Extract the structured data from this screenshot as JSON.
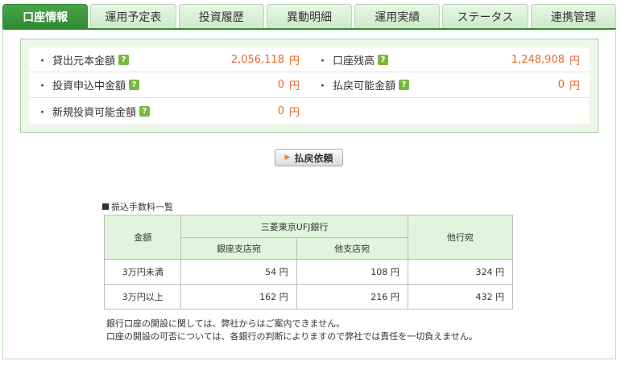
{
  "tabs": [
    {
      "label": "口座情報",
      "active": true
    },
    {
      "label": "運用予定表",
      "active": false
    },
    {
      "label": "投資履歴",
      "active": false
    },
    {
      "label": "異動明細",
      "active": false
    },
    {
      "label": "運用実績",
      "active": false
    },
    {
      "label": "ステータス",
      "active": false
    },
    {
      "label": "連携管理",
      "active": false
    }
  ],
  "summary": {
    "bullet": "・",
    "help_glyph": "?",
    "unit": "円",
    "loan_principal": {
      "label": "貸出元本金額",
      "value": "2,056,118"
    },
    "account_balance": {
      "label": "口座残高",
      "value": "1,248,908"
    },
    "pending_investment": {
      "label": "投資申込中金額",
      "value": "0"
    },
    "withdrawable": {
      "label": "払戻可能金額",
      "value": "0"
    },
    "new_investable": {
      "label": "新規投資可能金額",
      "value": "0"
    }
  },
  "withdraw_button": {
    "label": "払戻依頼"
  },
  "fee_table": {
    "title": "振込手数料一覧",
    "header_amount": "金額",
    "header_bank": "三菱東京UFJ銀行",
    "header_same_branch": "銀座支店宛",
    "header_other_branch": "他支店宛",
    "header_other_bank": "他行宛",
    "rows": [
      {
        "amount": "3万円未満",
        "same_branch": "54 円",
        "other_branch": "108 円",
        "other_bank": "324 円"
      },
      {
        "amount": "3万円以上",
        "same_branch": "162 円",
        "other_branch": "216 円",
        "other_bank": "432 円"
      }
    ]
  },
  "notes": {
    "line1": "銀行口座の開設に関しては、弊社からはご案内できません。",
    "line2": "口座の開設の可否については、各銀行の判断によりますので弊社では責任を一切負えません。"
  }
}
